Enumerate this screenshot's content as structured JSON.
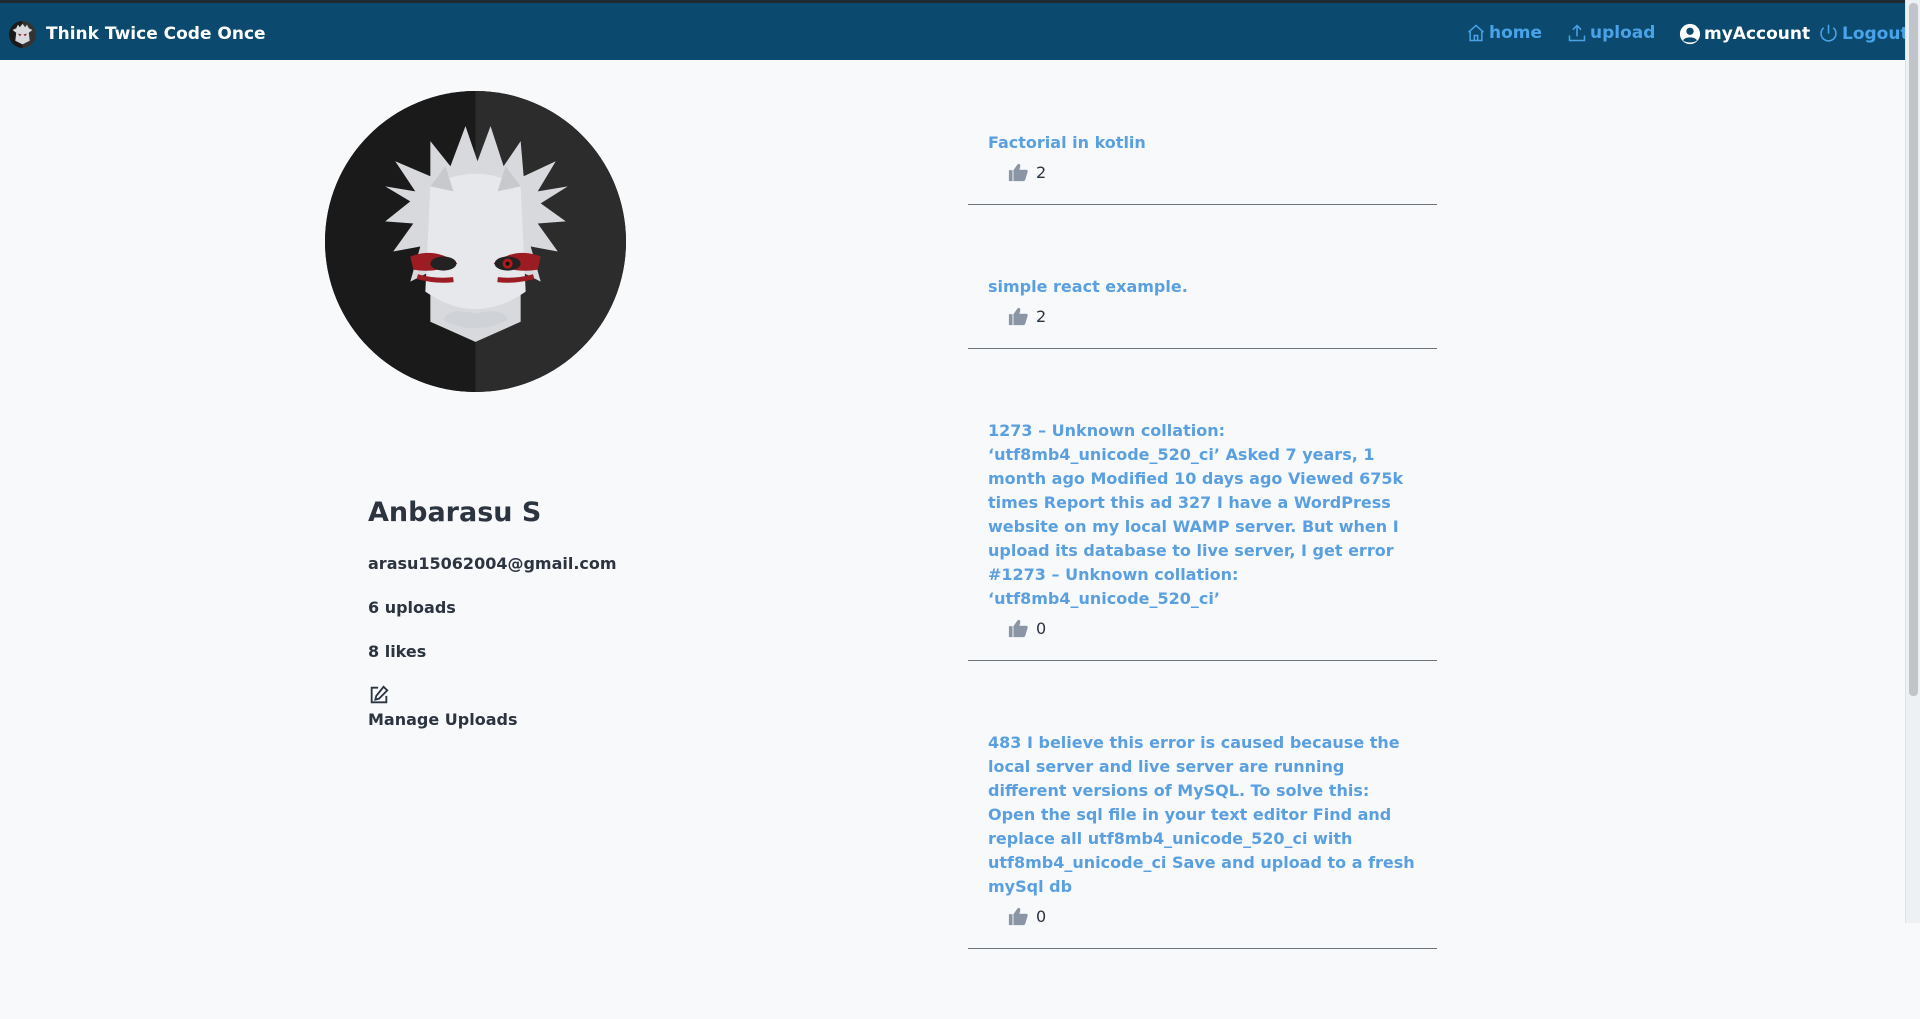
{
  "header": {
    "brand_title": "Think Twice Code Once",
    "nav": {
      "home": "home",
      "upload": "upload",
      "account": "myAccount",
      "logout": "Logout"
    }
  },
  "profile": {
    "name": "Anbarasu S",
    "email": "arasu15062004@gmail.com",
    "uploads": "6 uploads",
    "likes": "8 likes",
    "manage_label": "Manage Uploads"
  },
  "posts": [
    {
      "title": "Factorial in kotlin",
      "likes": "2"
    },
    {
      "title": "simple react example.",
      "likes": "2"
    },
    {
      "title": "1273 – Unknown collation: ‘utf8mb4_unicode_520_ci’ Asked 7 years, 1 month ago Modified 10 days ago Viewed 675k times Report this ad 327 I have a WordPress website on my local WAMP server. But when I upload its database to live server, I get error #1273 – Unknown collation: ‘utf8mb4_unicode_520_ci’",
      "likes": "0"
    },
    {
      "title": "483 I believe this error is caused because the local server and live server are running different versions of MySQL. To solve this: Open the sql file in your text editor Find and replace all utf8mb4_unicode_520_ci with utf8mb4_unicode_ci Save and upload to a fresh mySql db",
      "likes": "0"
    }
  ],
  "colors": {
    "header_bg": "#0b4a6e",
    "link": "#5a9fe0",
    "text": "#2c3440"
  }
}
